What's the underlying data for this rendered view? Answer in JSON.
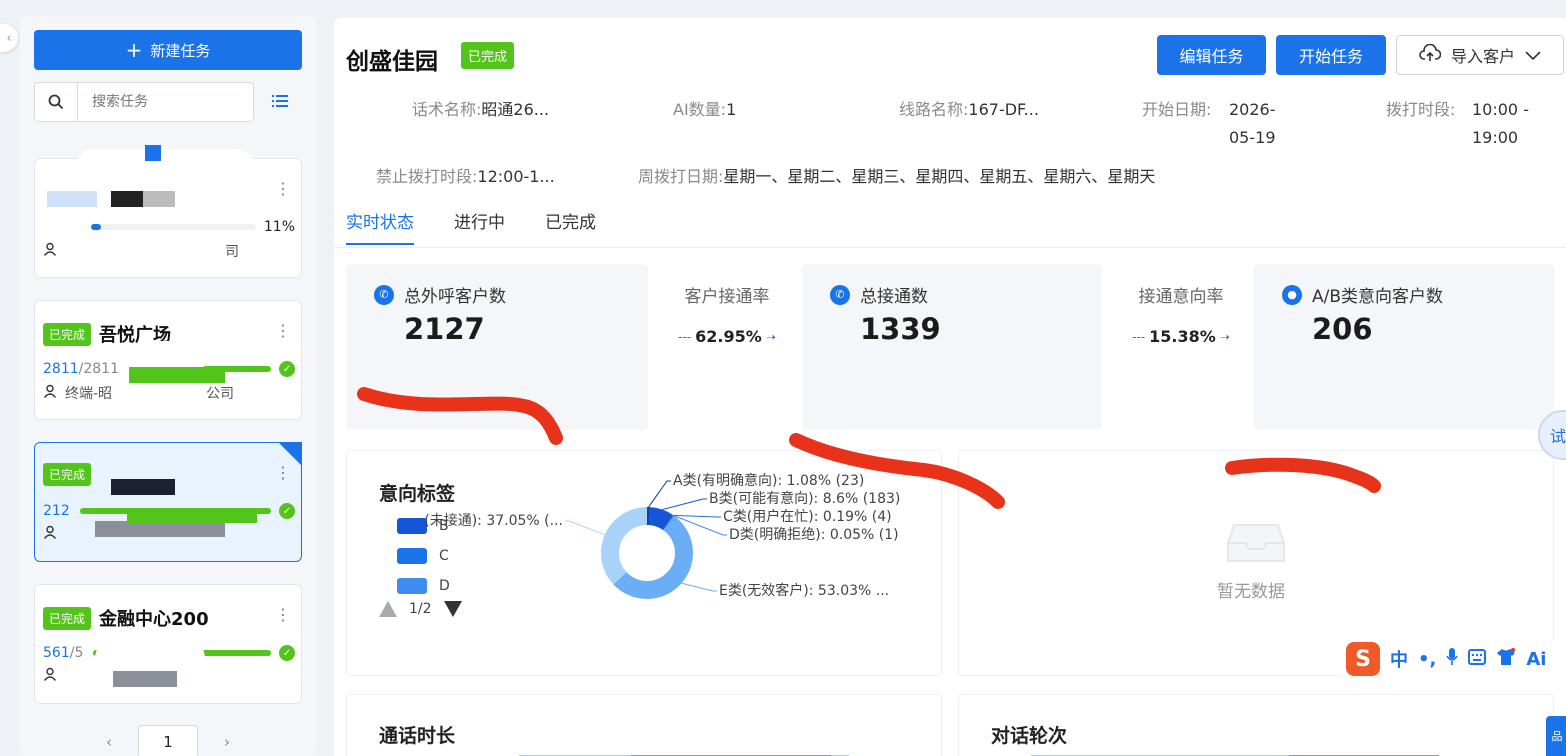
{
  "sidebar": {
    "new_task_label": "新建任务",
    "search_placeholder": "搜索任务",
    "tasks": [
      {
        "badge": "",
        "title": "",
        "done": "",
        "total": "",
        "percent_label": "11%",
        "progress": 0.11,
        "owner": "司"
      },
      {
        "badge": "已完成",
        "title": "吾悦广场",
        "done": "2811",
        "total": "/2811",
        "progress": 1.0,
        "owner": "终端-昭",
        "owner_suffix": "公司"
      },
      {
        "badge": "已完成",
        "title": "",
        "done": "212",
        "total": "",
        "progress": 1.0,
        "owner": ""
      },
      {
        "badge": "已完成",
        "title": "金融中心200",
        "done": "561",
        "total": "/5",
        "progress": 1.0,
        "owner": ""
      }
    ],
    "pager": {
      "page": "1"
    }
  },
  "header": {
    "title": "创盛佳园",
    "status_badge": "已完成",
    "edit_button": "编辑任务",
    "start_button": "开始任务",
    "import_button": "导入客户"
  },
  "info": {
    "script_label": "话术名称:",
    "script_value": "昭通26...",
    "ai_label": "AI数量:",
    "ai_value": "1",
    "line_label": "线路名称:",
    "line_value": "167-DF...",
    "start_label": "开始日期:",
    "start_value_1": "2026-",
    "start_value_2": "05-19",
    "dial_label": "拨打时段:",
    "dial_value_1": "10:00 -",
    "dial_value_2": "19:00",
    "forbid_label": "禁止拨打时段:",
    "forbid_value": "12:00-1...",
    "week_label": "周拨打日期:",
    "week_value": "星期一、星期二、星期三、星期四、星期五、星期六、星期天"
  },
  "tabs": [
    "实时状态",
    "进行中",
    "已完成"
  ],
  "stats": {
    "total_calls_label": "总外呼客户数",
    "total_calls_value": "2127",
    "connect_rate_label": "客户接通率",
    "connect_rate_value": "62.95%",
    "connected_label": "总接通数",
    "connected_value": "1339",
    "intent_rate_label": "接通意向率",
    "intent_rate_value": "15.38%",
    "ab_label": "A/B类意向客户数",
    "ab_value": "206"
  },
  "intent_panel": {
    "title": "意向标签",
    "legend": [
      "B",
      "C",
      "D"
    ],
    "legend_page": "1/2",
    "slices": [
      {
        "label": "A类(有明确意向): 1.08% (23)",
        "value": 1.08,
        "color": "#0b3fa8"
      },
      {
        "label": "B类(可能有意向): 8.6% (183)",
        "value": 8.6,
        "color": "#1556d6"
      },
      {
        "label": "C类(用户在忙): 0.19% (4)",
        "value": 0.19,
        "color": "#1a73e8"
      },
      {
        "label": "D类(明确拒绝): 0.05% (1)",
        "value": 0.05,
        "color": "#3d8cf0"
      },
      {
        "label": "E类(无效客户): 53.03% ...",
        "value": 53.03,
        "color": "#6aaef5"
      },
      {
        "label": "(未接通): 37.05% (...",
        "value": 37.05,
        "color": "#a9d2fa"
      }
    ]
  },
  "empty_panel": {
    "text": "暂无数据"
  },
  "bottom": {
    "call_duration_title": "通话时长",
    "dialog_rounds_title": "对话轮次"
  },
  "ime": {
    "chinese": "中",
    "punct": "•,",
    "ai": "Ai"
  },
  "float_tab": "试"
}
